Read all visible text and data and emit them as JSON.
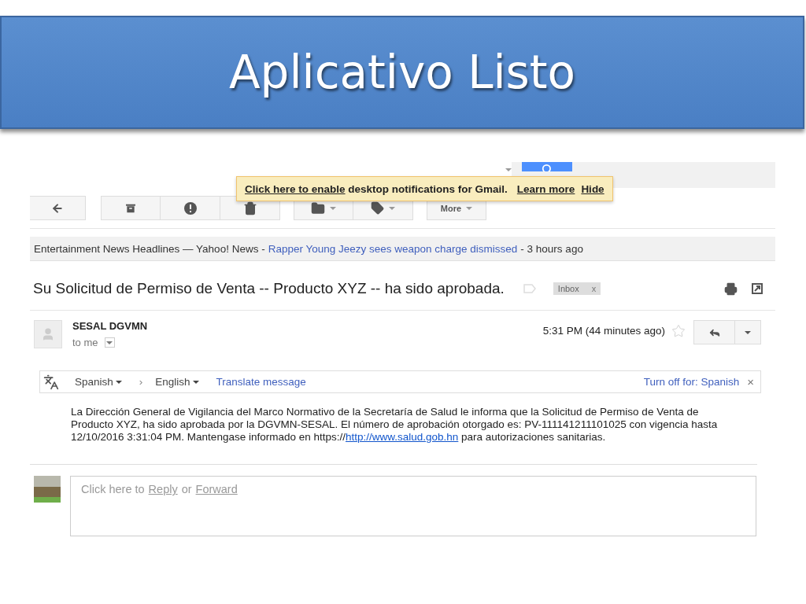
{
  "slide": {
    "title": "Aplicativo Listo"
  },
  "notification": {
    "link": "Click here to enable",
    "text": "desktop notifications for Gmail.",
    "learn_more": "Learn more",
    "hide": "Hide"
  },
  "toolbar": {
    "more": "More"
  },
  "news": {
    "source": "Entertainment News Headlines — Yahoo! News -",
    "headline": "Rapper Young Jeezy sees weapon charge dismissed",
    "time": "- 3 hours ago"
  },
  "message": {
    "subject": "Su Solicitud de Permiso de Venta -- Producto XYZ -- ha sido aprobada.",
    "label": "Inbox",
    "label_remove": "x",
    "sender": "SESAL DGVMN",
    "recipient": "to me",
    "time": "5:31 PM (44 minutes ago)",
    "starred": false
  },
  "translate": {
    "from": "Spanish",
    "separator": "›",
    "to": "English",
    "action": "Translate message",
    "turn_off": "Turn off for: Spanish",
    "close": "×"
  },
  "body": {
    "before": "La Dirección General de Vigilancia del Marco Normativo de la Secretaría de Salud le informa que la Solicitud de Permiso de Venta de Producto XYZ, ha sido aprobada por la DGVMN-SESAL. El número de aprobación otorgado es: PV-111141211101025 con vigencia hasta 12/10/2016 3:31:04 PM. Mantengase informado en https://",
    "link": "http://www.salud.gob.hn",
    "after": " para autorizaciones sanitarias."
  },
  "reply": {
    "prefix": "Click here to",
    "reply": "Reply",
    "or": "or",
    "forward": "Forward"
  }
}
